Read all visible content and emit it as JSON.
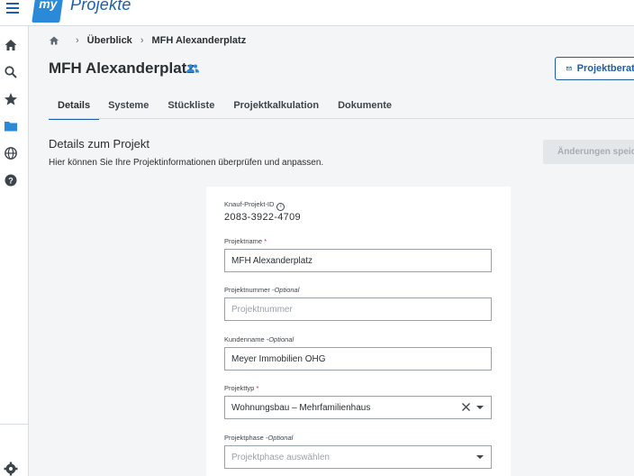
{
  "app": {
    "logo_badge": "my",
    "logo_text": "Projekte"
  },
  "breadcrumb": {
    "items": [
      "Überblick",
      "MFH Alexanderplatz"
    ]
  },
  "page": {
    "title": "MFH Alexanderplatz",
    "consult_button": "Projektberatung"
  },
  "tabs": [
    {
      "label": "Details",
      "active": true
    },
    {
      "label": "Systeme"
    },
    {
      "label": "Stückliste"
    },
    {
      "label": "Projektkalkulation"
    },
    {
      "label": "Dokumente"
    }
  ],
  "section": {
    "title": "Details zum Projekt",
    "description": "Hier können Sie Ihre Projektinformationen überprüfen und anpassen.",
    "save_button": "Änderungen speichern"
  },
  "form": {
    "project_id": {
      "label": "Knauf-Projekt-ID",
      "value": "2083-3922-4709"
    },
    "project_name": {
      "label": "Projektname",
      "required_mark": "*",
      "value": "MFH Alexanderplatz"
    },
    "project_number": {
      "label": "Projektnummer",
      "optional": "-Optional",
      "placeholder": "Projektnummer"
    },
    "customer_name": {
      "label": "Kundenname",
      "optional": "-Optional",
      "value": "Meyer Immobilien OHG"
    },
    "project_type": {
      "label": "Projekttyp",
      "required_mark": "*",
      "value": "Wohnungsbau – Mehrfamilienhaus"
    },
    "project_phase": {
      "label": "Projektphase",
      "optional": "-Optional",
      "placeholder": "Projektphase auswählen"
    }
  },
  "colors": {
    "accent": "#1c5fa8",
    "logo_blue": "#2a8ad8",
    "required": "#c0262d"
  }
}
